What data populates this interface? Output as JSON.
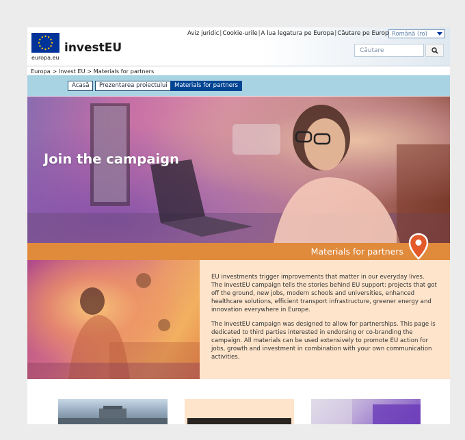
{
  "header": {
    "logo_caption": "europa.eu",
    "site_title": "investEU",
    "top_links": [
      "Aviz juridic",
      "Cookie-urile",
      "A lua legatura pe Europa",
      "Căutare pe Europa"
    ],
    "language": "Română (ro)",
    "search_placeholder": "Căutare"
  },
  "breadcrumb": "Europa > Invest EU > Materials for partners",
  "nav": {
    "tabs": [
      {
        "label": "Acasă",
        "active": false
      },
      {
        "label": "Prezentarea proiectului",
        "active": false
      },
      {
        "label": "Materials for partners",
        "active": true
      }
    ]
  },
  "hero": {
    "title": "Join the campaign",
    "banner_label": "Materials for partners"
  },
  "content": {
    "paragraph_1": "EU investments trigger improvements that matter in our everyday lives. The investEU campaign tells the stories behind EU support: projects that got off the ground, new jobs, modern schools and universities, enhanced healthcare solutions, efficient transport infrastructure, greener energy and innovation everywhere in Europe.",
    "paragraph_2": "The investEU campaign was designed to allow for partnerships. This page is dedicated to third parties interested in endorsing or co-branding the campaign. All materials can be used extensively to promote EU action for jobs, growth and investment in combination with your own communication activities."
  },
  "colors": {
    "eu_blue": "#003399",
    "nav_bg": "#a8d3e3",
    "active_tab": "#004494",
    "orange": "#e08a3c",
    "peach": "#fde4cb"
  },
  "icons": [
    "eu-flag-icon",
    "search-icon",
    "chevron-down-icon",
    "location-pin-icon"
  ]
}
